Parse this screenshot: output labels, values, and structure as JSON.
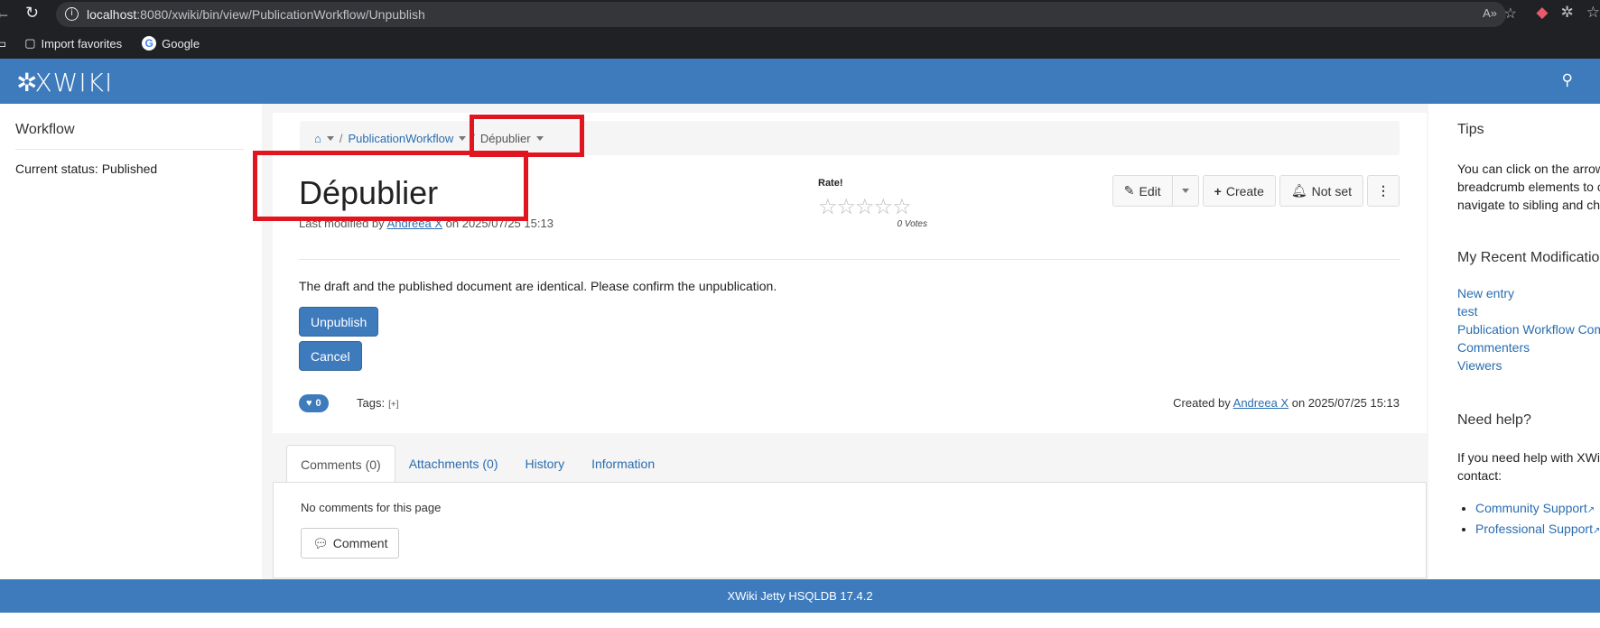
{
  "browser": {
    "url_host": "localhost",
    "url_rest": ":8080/xwiki/bin/view/PublicationWorkflow/Unpublish",
    "bookmarks": [
      {
        "label": "Import favorites"
      },
      {
        "label": "Google"
      }
    ]
  },
  "header": {
    "logo": "XWIKI"
  },
  "left": {
    "title": "Workflow",
    "status": "Current status: Published"
  },
  "breadcrumb": {
    "items": [
      "PublicationWorkflow",
      "Dépublier"
    ]
  },
  "page": {
    "title": "Dépublier",
    "lastmod_prefix": "Last modified by",
    "author": "Andreea X",
    "lastmod_suffix": "on 2025/07/25 15:13",
    "rate_label": "Rate!",
    "votes": "0 Votes",
    "message": "The draft and the published document are identical. Please confirm the unpublication.",
    "unpublish_label": "Unpublish",
    "cancel_label": "Cancel",
    "likes": "0",
    "tags_label": "Tags:",
    "tags_add": "[+]",
    "created_prefix": "Created by",
    "created_author": "Andreea X",
    "created_suffix": "on 2025/07/25 15:13"
  },
  "actions": {
    "edit": "Edit",
    "create": "Create",
    "notify": "Not set"
  },
  "tabs": [
    {
      "label": "Comments (0)"
    },
    {
      "label": "Attachments (0)"
    },
    {
      "label": "History"
    },
    {
      "label": "Information"
    }
  ],
  "comments": {
    "empty": "No comments for this page",
    "button": "Comment"
  },
  "right": {
    "tips_title": "Tips",
    "tips_lines": [
      "You can click on the arrow",
      "breadcrumb elements to c",
      "navigate to sibling and ch"
    ],
    "recent_title": "My Recent Modificatio",
    "recent": [
      "New entry",
      "test",
      "Publication Workflow Com",
      "Commenters",
      "Viewers"
    ],
    "help_title": "Need help?",
    "help_lines": [
      "If you need help with XWi",
      "contact:"
    ],
    "help_links": [
      "Community Support",
      "Professional Support"
    ]
  },
  "footer": "XWiki Jetty HSQLDB 17.4.2",
  "colors": {
    "brand": "#3e7bbd",
    "highlight": "#e0151f"
  }
}
